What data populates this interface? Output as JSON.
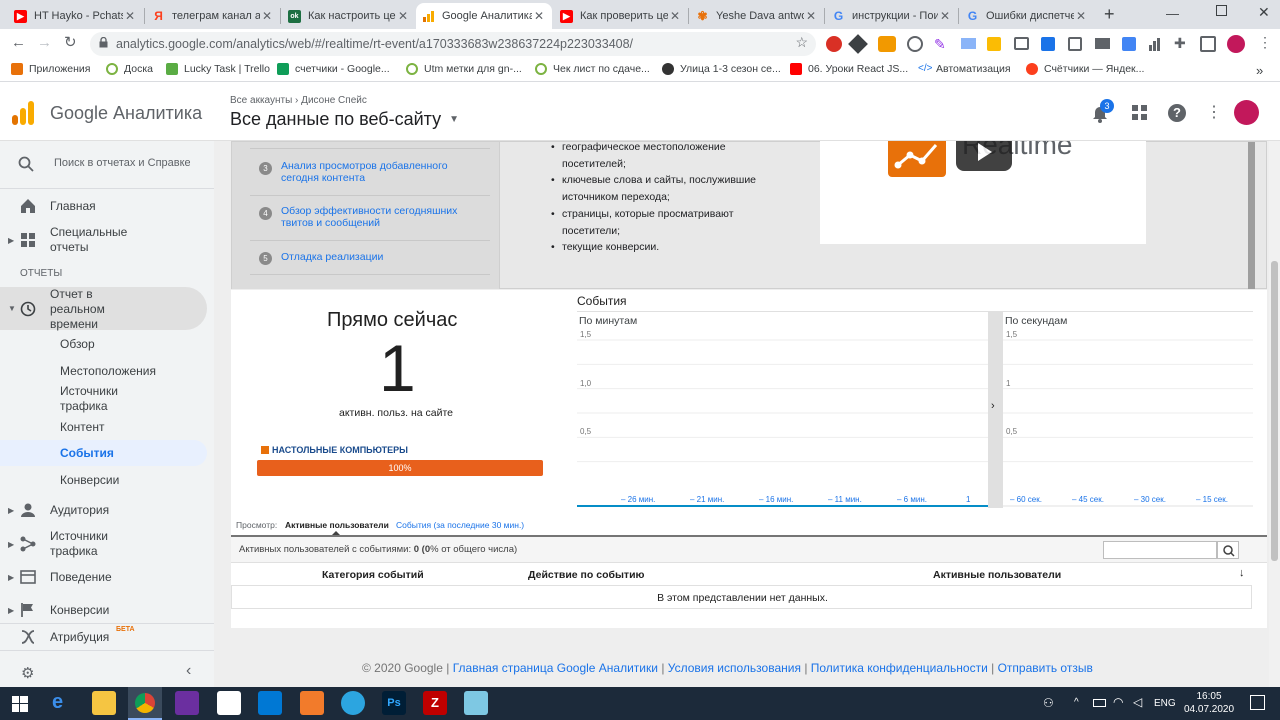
{
  "browser": {
    "tabs": [
      {
        "title": "HT Hayko - Pchats",
        "icon": "youtube-icon",
        "color": "#ff0000"
      },
      {
        "title": "телеграм канал ас",
        "icon": "yandex-icon",
        "color": "#fc3f1d"
      },
      {
        "title": "Как настроить це",
        "icon": "excel-icon",
        "color": "#1d6f42"
      },
      {
        "title": "Google Аналитика",
        "icon": "analytics-icon",
        "color": "#f9ab00"
      },
      {
        "title": "Как проверить це",
        "icon": "youtube-icon",
        "color": "#ff0000"
      },
      {
        "title": "Yeshe Dava antwo",
        "icon": "flower-icon",
        "color": "#e8710a"
      },
      {
        "title": "инструкции - Пои",
        "icon": "google-icon",
        "color": "#4285f4"
      },
      {
        "title": "Ошибки диспетче",
        "icon": "google-icon",
        "color": "#4285f4"
      }
    ],
    "new_tab": "+",
    "url": "analytics.google.com/analytics/web/#/realtime/rt-event/a170333683w238637224p223033408/",
    "bookmarks": [
      {
        "label": "Приложения",
        "color": "#e8710a"
      },
      {
        "label": "Доска",
        "color": "#7cb342"
      },
      {
        "label": "Lucky Task | Trello",
        "color": "#5aac44"
      },
      {
        "label": "счетчики - Google...",
        "color": "#0f9d58"
      },
      {
        "label": "Utm метки для gn-...",
        "color": "#7cb342"
      },
      {
        "label": "Чек лист по сдаче...",
        "color": "#7cb342"
      },
      {
        "label": "Улица 1-3 сезон се...",
        "color": "#333333"
      },
      {
        "label": "06. Уроки React JS...",
        "color": "#ff0000"
      },
      {
        "label": "Автоматизация",
        "color": "#1a73e8"
      },
      {
        "label": "Счётчики — Яндек...",
        "color": "#fc3f1d"
      }
    ],
    "bookmarks_more": "»"
  },
  "ga": {
    "brand": "Google Аналитика",
    "breadcrumb": "Все аккаунты › Дисоне Спейс",
    "view_title": "Все данные по веб-сайту",
    "notif_count": "3",
    "accent": "#e8710a"
  },
  "sidebar": {
    "search_placeholder": "Поиск в отчетах и Справке",
    "home": "Главная",
    "custom": "Специальные отчеты",
    "section": "ОТЧЕТЫ",
    "realtime": "Отчет в реальном времени",
    "realtime_items": [
      "Обзор",
      "Местоположения",
      "Источники трафика",
      "Контент",
      "События",
      "Конверсии"
    ],
    "audience": "Аудитория",
    "acquisition": "Источники трафика",
    "behavior": "Поведение",
    "conversions": "Конверсии",
    "attribution": "Атрибуция",
    "beta": "БЕТА"
  },
  "intro": {
    "steps": [
      {
        "num": "3",
        "text": "Анализ просмотров добавленного сегодня контента"
      },
      {
        "num": "4",
        "text": "Обзор эффективности сегодняшних твитов и сообщений"
      },
      {
        "num": "5",
        "text": "Отладка реализации"
      }
    ],
    "bullets": [
      "географическое местоположение посетителей;",
      "ключевые слова и сайты, послужившие источником перехода;",
      "страницы, которые просматривают посетители;",
      "текущие конверсии."
    ],
    "video_label": "Realtime"
  },
  "now": {
    "title": "Прямо сейчас",
    "count": "1",
    "caption": "активн. польз. на сайте",
    "device_label": "НАСТОЛЬНЫЕ КОМПЬЮТЕРЫ",
    "device_pct": "100%",
    "device_fraction": 1.0
  },
  "events_chart": {
    "title": "События",
    "per_minute": "По минутам",
    "per_second": "По секундам",
    "minute_y": [
      "1,5",
      "1,0",
      "0,5"
    ],
    "minute_x": [
      "– 26 мин.",
      "– 21 мин.",
      "– 16 мин.",
      "– 11 мин.",
      "– 6 мин.",
      "1"
    ],
    "second_y": [
      "1,5",
      "1",
      "0,5"
    ],
    "second_x": [
      "– 60 сек.",
      "– 45 сек.",
      "– 30 сек.",
      "– 15 сек."
    ]
  },
  "chart_data": [
    {
      "type": "bar",
      "title": "По минутам",
      "categories": [
        "– 26 мин.",
        "– 21 мин.",
        "– 16 мин.",
        "– 11 мин.",
        "– 6 мин.",
        "1"
      ],
      "values": [
        0,
        0,
        0,
        0,
        0,
        0
      ],
      "yticks": [
        "1,5",
        "1,0",
        "0,5"
      ],
      "ylim": [
        0,
        1.5
      ]
    },
    {
      "type": "bar",
      "title": "По секундам",
      "categories": [
        "– 60 сек.",
        "– 45 сек.",
        "– 30 сек.",
        "– 15 сек."
      ],
      "values": [
        0,
        0,
        0,
        0
      ],
      "yticks": [
        "1,5",
        "1",
        "0,5"
      ],
      "ylim": [
        0,
        1.5
      ]
    }
  ],
  "view": {
    "label": "Просмотр:",
    "active_tab": "Активные пользователи",
    "other_tab": "События (за последние 30 мин.)"
  },
  "table": {
    "summary_prefix": "Активных пользователей с событиями:",
    "summary_value": "0",
    "summary_pct_bold": "(0",
    "summary_rest": "% от общего числа)",
    "columns": [
      "Категория событий",
      "Действие по событию",
      "Активные пользователи"
    ],
    "empty": "В этом представлении нет данных."
  },
  "footer": {
    "copyright": "© 2020 Google",
    "links": [
      "Главная страница Google Аналитики",
      "Условия использования",
      "Политика конфиденциальности",
      "Отправить отзыв"
    ]
  },
  "taskbar": {
    "lang": "ENG",
    "time": "16:05",
    "date": "04.07.2020"
  }
}
